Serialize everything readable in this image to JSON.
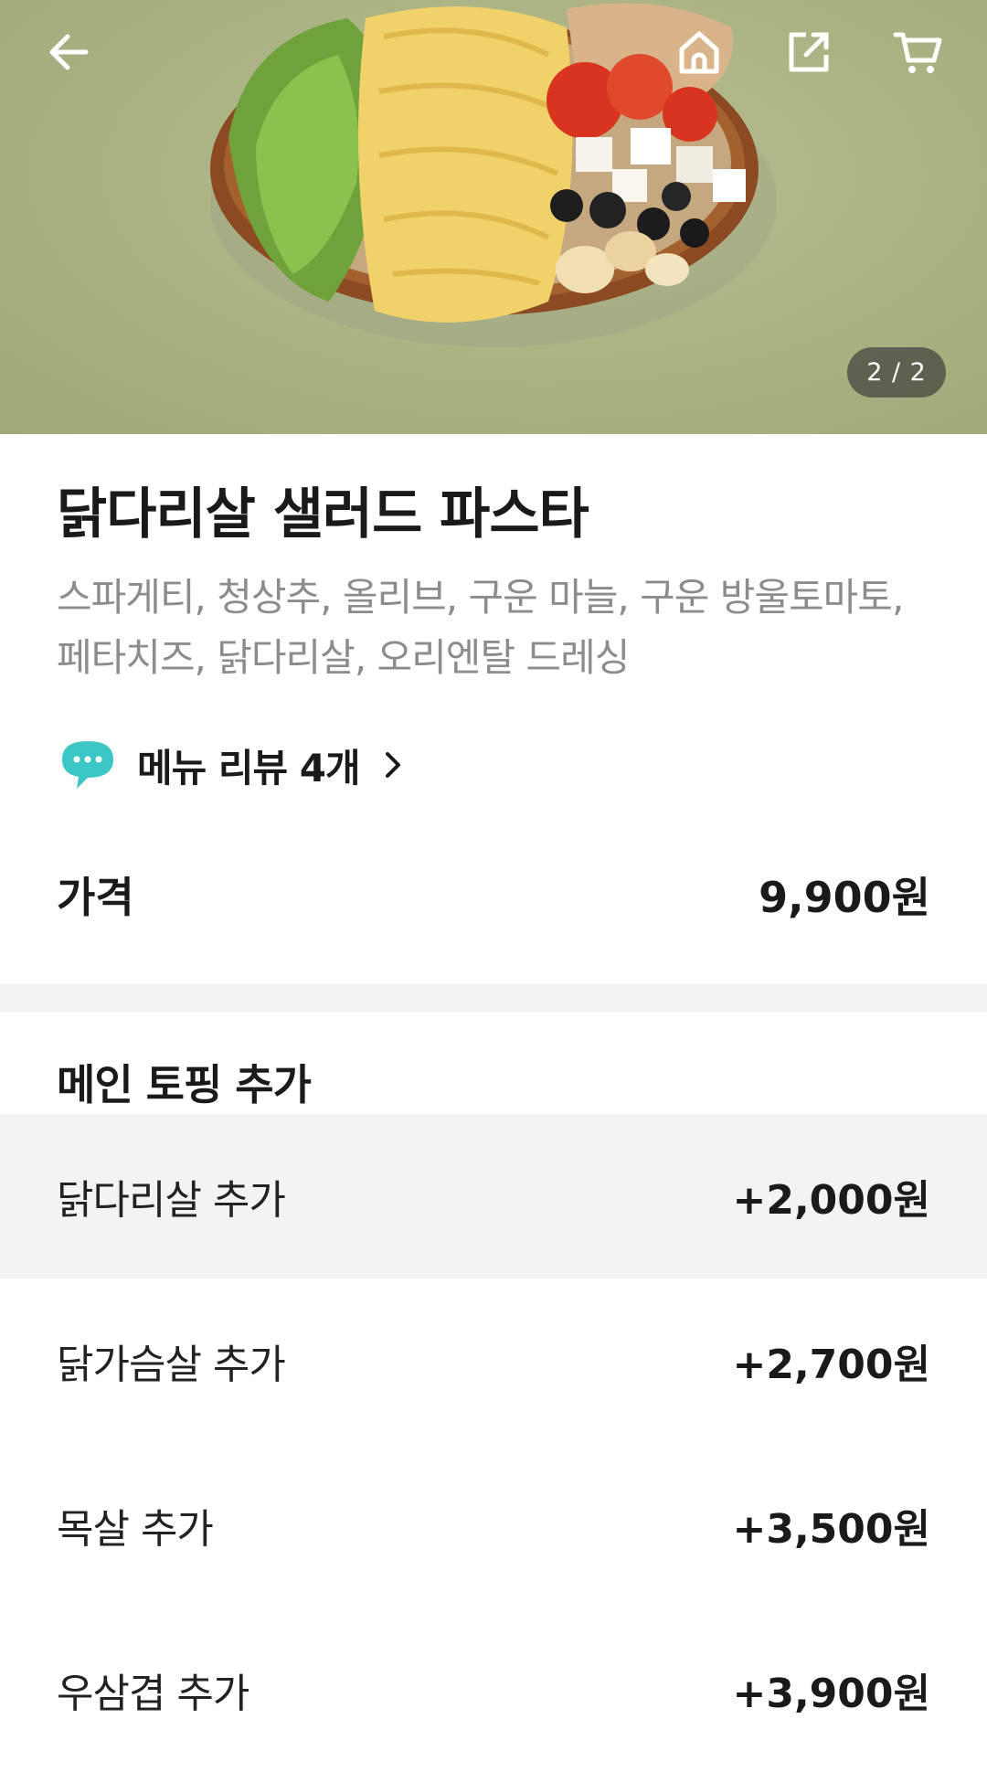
{
  "header": {
    "back_icon": "arrow-left-icon",
    "home_icon": "home-icon",
    "share_icon": "share-icon",
    "cart_icon": "cart-icon"
  },
  "gallery": {
    "counter": "2 / 2"
  },
  "product": {
    "title": "닭다리살 샐러드 파스타",
    "description": "스파게티, 청상추, 올리브, 구운 마늘, 구운 방울토마토, 페타치즈, 닭다리살, 오리엔탈 드레싱",
    "review_label": "메뉴 리뷰 4개",
    "price_label": "가격",
    "price_value": "9,900원"
  },
  "toppings": {
    "section_title": "메인 토핑 추가",
    "options": [
      {
        "name": "닭다리살 추가",
        "price": "+2,000원"
      },
      {
        "name": "닭가슴살 추가",
        "price": "+2,700원"
      },
      {
        "name": "목살 추가",
        "price": "+3,500원"
      },
      {
        "name": "우삼겹 추가",
        "price": "+3,900원"
      }
    ]
  },
  "colors": {
    "accent": "#3cc6c6",
    "divider": "#f2f3f5",
    "highlight": "#f3f3f3"
  }
}
